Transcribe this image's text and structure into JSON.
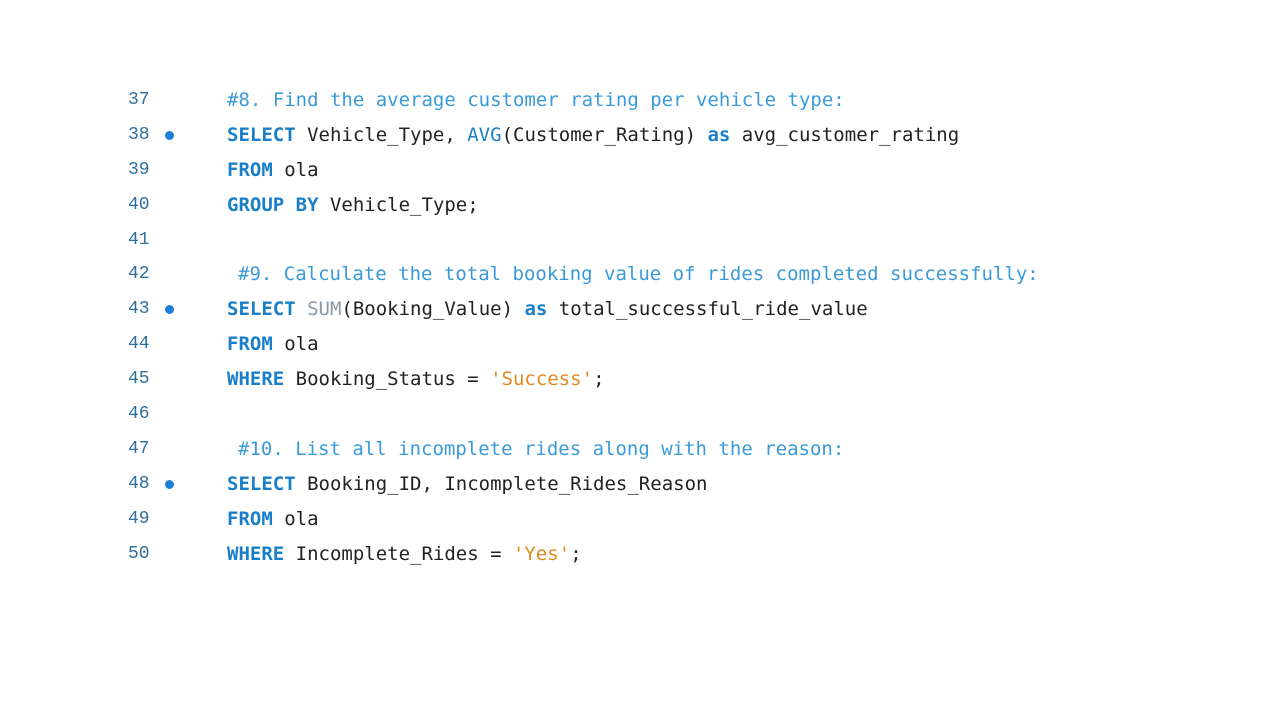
{
  "editor": {
    "lines": [
      {
        "number": "37",
        "breakpoint": false,
        "indent": false,
        "tokens": [
          {
            "type": "cmt",
            "text": "#8. Find the average customer rating per vehicle type:"
          }
        ]
      },
      {
        "number": "38",
        "breakpoint": true,
        "indent": false,
        "tokens": [
          {
            "type": "kw",
            "text": "SELECT"
          },
          {
            "type": "id",
            "text": " Vehicle_Type, "
          },
          {
            "type": "fn",
            "text": "AVG"
          },
          {
            "type": "id",
            "text": "(Customer_Rating) "
          },
          {
            "type": "kw",
            "text": "as"
          },
          {
            "type": "id",
            "text": " avg_customer_rating"
          }
        ]
      },
      {
        "number": "39",
        "breakpoint": false,
        "indent": false,
        "tokens": [
          {
            "type": "kw",
            "text": "FROM"
          },
          {
            "type": "id",
            "text": " ola"
          }
        ]
      },
      {
        "number": "40",
        "breakpoint": false,
        "indent": false,
        "tokens": [
          {
            "type": "kw",
            "text": "GROUP BY"
          },
          {
            "type": "id",
            "text": " Vehicle_Type;"
          }
        ]
      },
      {
        "number": "41",
        "breakpoint": false,
        "indent": false,
        "tokens": []
      },
      {
        "number": "42",
        "breakpoint": false,
        "indent": true,
        "tokens": [
          {
            "type": "cmt",
            "text": "#9. Calculate the total booking value of rides completed successfully:"
          }
        ]
      },
      {
        "number": "43",
        "breakpoint": true,
        "indent": false,
        "tokens": [
          {
            "type": "kw",
            "text": "SELECT"
          },
          {
            "type": "id",
            "text": " "
          },
          {
            "type": "fn-sum",
            "text": "SUM"
          },
          {
            "type": "id",
            "text": "(Booking_Value) "
          },
          {
            "type": "kw",
            "text": "as"
          },
          {
            "type": "id",
            "text": " total_successful_ride_value"
          }
        ]
      },
      {
        "number": "44",
        "breakpoint": false,
        "indent": false,
        "tokens": [
          {
            "type": "kw",
            "text": "FROM"
          },
          {
            "type": "id",
            "text": " ola"
          }
        ]
      },
      {
        "number": "45",
        "breakpoint": false,
        "indent": false,
        "tokens": [
          {
            "type": "kw",
            "text": "WHERE"
          },
          {
            "type": "id",
            "text": " Booking_Status = "
          },
          {
            "type": "str",
            "text": "'Success'"
          },
          {
            "type": "id",
            "text": ";"
          }
        ]
      },
      {
        "number": "46",
        "breakpoint": false,
        "indent": false,
        "tokens": []
      },
      {
        "number": "47",
        "breakpoint": false,
        "indent": true,
        "tokens": [
          {
            "type": "cmt",
            "text": "#10. List all incomplete rides along with the reason:"
          }
        ]
      },
      {
        "number": "48",
        "breakpoint": true,
        "indent": false,
        "tokens": [
          {
            "type": "kw",
            "text": "SELECT"
          },
          {
            "type": "id",
            "text": " Booking_ID, Incomplete_Rides_Reason"
          }
        ]
      },
      {
        "number": "49",
        "breakpoint": false,
        "indent": false,
        "tokens": [
          {
            "type": "kw",
            "text": "FROM"
          },
          {
            "type": "id",
            "text": " ola"
          }
        ]
      },
      {
        "number": "50",
        "breakpoint": false,
        "indent": false,
        "tokens": [
          {
            "type": "kw",
            "text": "WHERE"
          },
          {
            "type": "id",
            "text": " Incomplete_Rides = "
          },
          {
            "type": "str",
            "text": "'Yes'"
          },
          {
            "type": "id",
            "text": ";"
          }
        ]
      }
    ]
  },
  "colors": {
    "keyword": "#1a7fc8",
    "comment": "#3a9ad9",
    "string": "#e08a1e",
    "line_number": "#2e6f9e",
    "breakpoint": "#1e7fd6",
    "background": "#ffffff"
  }
}
